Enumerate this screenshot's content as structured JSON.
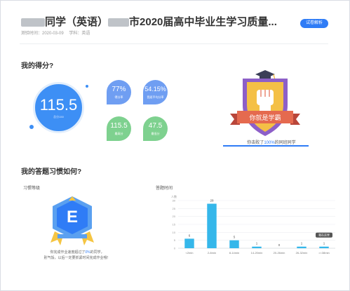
{
  "header": {
    "title_pre": "同学（英语）",
    "title_post": "市2020届高中毕业生学习质量...",
    "test_time": "测验时间：2020-03-09",
    "subject": "学科：英语",
    "report_button": "试卷解析"
  },
  "score_section": {
    "title": "我的得分?",
    "total_score": "115.5",
    "total_label": "总分150",
    "stats": [
      {
        "value": "77%",
        "label": "得分率",
        "color": "#6f9ef2"
      },
      {
        "value": "54.15%",
        "label": "我班平均分率",
        "color": "#6f9ef2"
      },
      {
        "value": "115.5",
        "label": "最高分",
        "color": "#7ed18f"
      },
      {
        "value": "47.5",
        "label": "最低分",
        "color": "#7ed18f"
      }
    ],
    "badge_text": "你就是学霸",
    "rank_prefix": "你击败了",
    "rank_pct": "100%",
    "rank_suffix": "的同班同学"
  },
  "habit_section": {
    "title": "我的答题习惯如何?",
    "habit_label": "习惯等级",
    "grade": "E",
    "caption_pre": "你完成作业速度超过了",
    "caption_pct": "0%",
    "caption_post": "的同学，",
    "caption_line2": "别气馁，以后一定要抓紧时间完成作业哦！",
    "answer_label": "答题时间"
  },
  "chart_data": {
    "type": "bar",
    "categories": [
      "<2min",
      "2-8min",
      "8-14min",
      "14-20min",
      "20-26min",
      "26-32min",
      ">=38min"
    ],
    "values": [
      6,
      28,
      5,
      1,
      0,
      1,
      1
    ],
    "ylabel": "人数",
    "ylim": [
      0,
      30
    ],
    "yticks": [
      0,
      5,
      10,
      15,
      20,
      25,
      30
    ],
    "tooltip": "我在这里",
    "bar_color": "#35b7ea",
    "grid": true
  }
}
